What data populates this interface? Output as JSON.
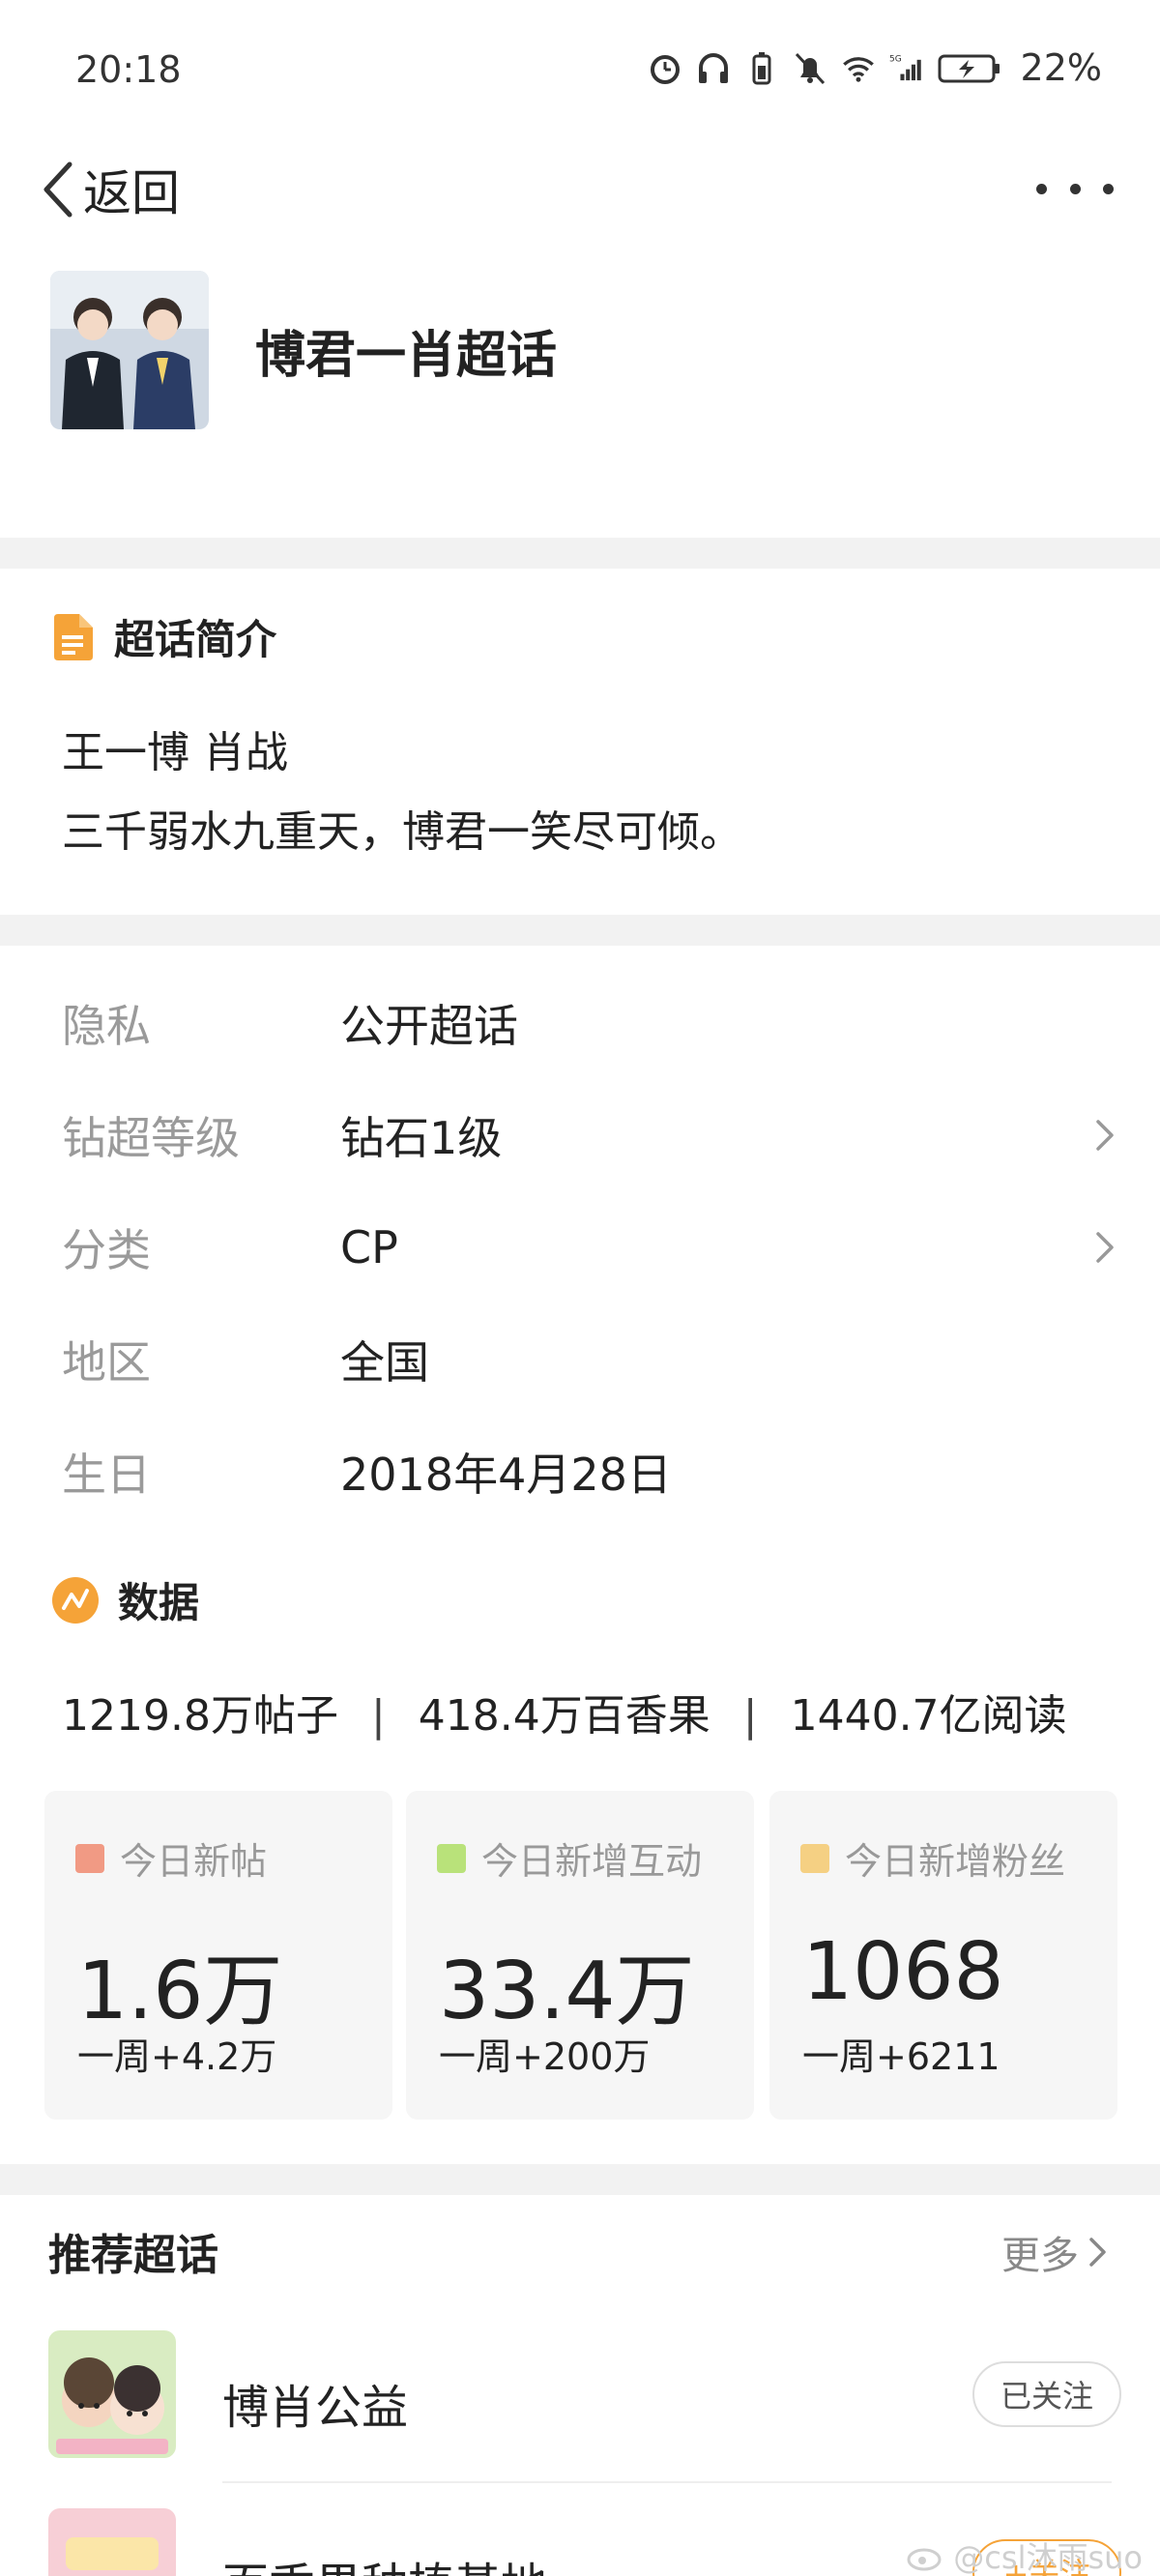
{
  "status": {
    "time": "20:18",
    "battery": "22%"
  },
  "nav": {
    "back_label": "返回"
  },
  "topic": {
    "title": "博君一肖超话"
  },
  "intro": {
    "heading": "超话简介",
    "line1": "王一博 肖战",
    "line2": "三千弱水九重天，博君一笑尽可倾。"
  },
  "info": [
    {
      "key": "隐私",
      "value": "公开超话"
    },
    {
      "key": "钻超等级",
      "value": "钻石1级"
    },
    {
      "key": "分类",
      "value": "CP"
    },
    {
      "key": "地区",
      "value": "全国"
    },
    {
      "key": "生日",
      "value": "2018年4月28日"
    }
  ],
  "data_section": {
    "heading": "数据",
    "posts": "1219.8万帖子",
    "fruit": "418.4万百香果",
    "reads": "1440.7亿阅读",
    "separator": "|"
  },
  "cards": [
    {
      "label": "今日新帖",
      "value": "1.6万",
      "week": "一周+4.2万",
      "color": "#f19a84"
    },
    {
      "label": "今日新增互动",
      "value": "33.4万",
      "week": "一周+200万",
      "color": "#b9e27a"
    },
    {
      "label": "今日新增粉丝",
      "value": "1068",
      "week": "一周+6211",
      "color": "#f5d083"
    }
  ],
  "recommend": {
    "heading": "推荐超话",
    "more_label": "更多",
    "items": [
      {
        "name": "博肖公益",
        "button": "已关注"
      },
      {
        "name": "百香果种植基地",
        "button": "+关注"
      }
    ]
  },
  "watermark": "@csl沐雨suo",
  "colors": {
    "accent_orange": "#f5a338",
    "gap_gray": "#f2f2f2"
  }
}
